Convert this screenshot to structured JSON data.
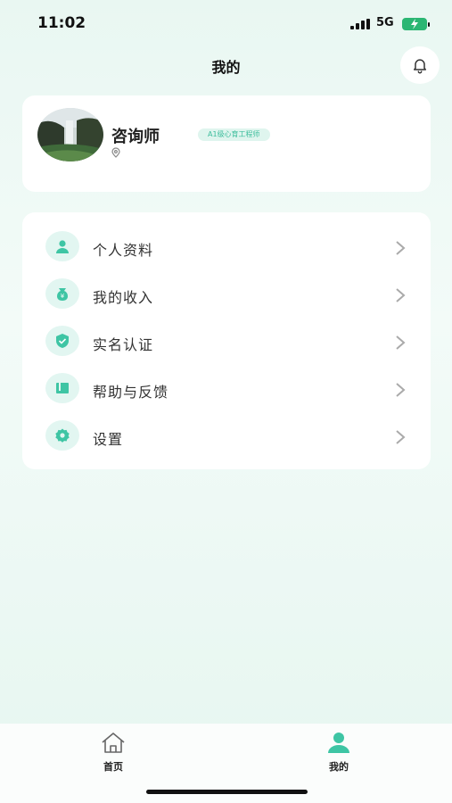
{
  "status_bar": {
    "time": "11:02",
    "network": "5G"
  },
  "header": {
    "title": "我的"
  },
  "profile": {
    "name": "咨询师",
    "badge": "A1级心育工程师"
  },
  "menu": {
    "items": [
      {
        "label": "个人资料",
        "icon": "person-icon"
      },
      {
        "label": "我的收入",
        "icon": "income-icon"
      },
      {
        "label": "实名认证",
        "icon": "shield-check-icon"
      },
      {
        "label": "帮助与反馈",
        "icon": "book-icon"
      },
      {
        "label": "设置",
        "icon": "gear-icon"
      }
    ]
  },
  "tabbar": {
    "tabs": [
      {
        "label": "首页",
        "icon": "home-icon",
        "active": false
      },
      {
        "label": "我的",
        "icon": "user-icon",
        "active": true
      }
    ]
  },
  "colors": {
    "accent": "#3ec5a4",
    "icon_bg": "#e2f6f1",
    "battery": "#2bb673"
  }
}
